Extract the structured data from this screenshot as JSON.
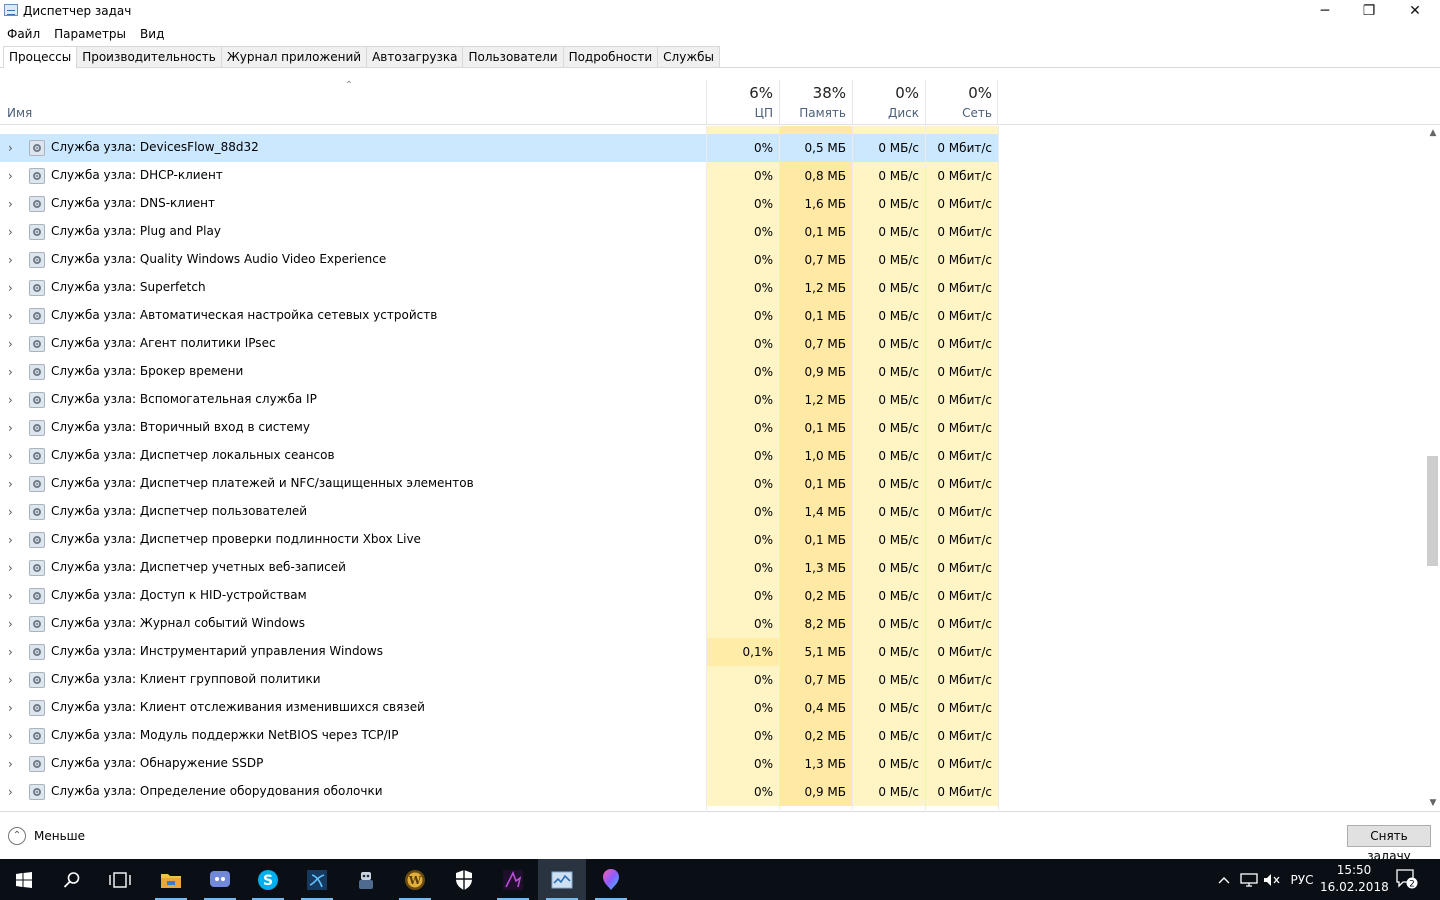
{
  "window": {
    "title": "Диспетчер задач",
    "minimize": "─",
    "maximize": "❐",
    "close": "✕"
  },
  "menu": [
    "Файл",
    "Параметры",
    "Вид"
  ],
  "tabs": [
    {
      "label": "Процессы",
      "active": true
    },
    {
      "label": "Производительность",
      "active": false
    },
    {
      "label": "Журнал приложений",
      "active": false
    },
    {
      "label": "Автозагрузка",
      "active": false
    },
    {
      "label": "Пользователи",
      "active": false
    },
    {
      "label": "Подробности",
      "active": false
    },
    {
      "label": "Службы",
      "active": false
    }
  ],
  "columns": {
    "name": "Имя",
    "cpu": {
      "pct": "6%",
      "label": "ЦП"
    },
    "memory": {
      "pct": "38%",
      "label": "Память"
    },
    "disk": {
      "pct": "0%",
      "label": "Диск"
    },
    "network": {
      "pct": "0%",
      "label": "Сеть"
    }
  },
  "processes": [
    {
      "name": "Служба узла: DevicesFlow_88d32",
      "cpu": "0%",
      "mem": "0,5 МБ",
      "disk": "0 МБ/с",
      "net": "0 Мбит/с",
      "selected": true
    },
    {
      "name": "Служба узла: DHCP-клиент",
      "cpu": "0%",
      "mem": "0,8 МБ",
      "disk": "0 МБ/с",
      "net": "0 Мбит/с"
    },
    {
      "name": "Служба узла: DNS-клиент",
      "cpu": "0%",
      "mem": "1,6 МБ",
      "disk": "0 МБ/с",
      "net": "0 Мбит/с"
    },
    {
      "name": "Служба узла: Plug and Play",
      "cpu": "0%",
      "mem": "0,1 МБ",
      "disk": "0 МБ/с",
      "net": "0 Мбит/с"
    },
    {
      "name": "Служба узла: Quality Windows Audio Video Experience",
      "cpu": "0%",
      "mem": "0,7 МБ",
      "disk": "0 МБ/с",
      "net": "0 Мбит/с"
    },
    {
      "name": "Служба узла: Superfetch",
      "cpu": "0%",
      "mem": "1,2 МБ",
      "disk": "0 МБ/с",
      "net": "0 Мбит/с"
    },
    {
      "name": "Служба узла: Автоматическая настройка сетевых устройств",
      "cpu": "0%",
      "mem": "0,1 МБ",
      "disk": "0 МБ/с",
      "net": "0 Мбит/с"
    },
    {
      "name": "Служба узла: Агент политики IPsec",
      "cpu": "0%",
      "mem": "0,7 МБ",
      "disk": "0 МБ/с",
      "net": "0 Мбит/с"
    },
    {
      "name": "Служба узла: Брокер времени",
      "cpu": "0%",
      "mem": "0,9 МБ",
      "disk": "0 МБ/с",
      "net": "0 Мбит/с"
    },
    {
      "name": "Служба узла: Вспомогательная служба IP",
      "cpu": "0%",
      "mem": "1,2 МБ",
      "disk": "0 МБ/с",
      "net": "0 Мбит/с"
    },
    {
      "name": "Служба узла: Вторичный вход в систему",
      "cpu": "0%",
      "mem": "0,1 МБ",
      "disk": "0 МБ/с",
      "net": "0 Мбит/с"
    },
    {
      "name": "Служба узла: Диспетчер локальных сеансов",
      "cpu": "0%",
      "mem": "1,0 МБ",
      "disk": "0 МБ/с",
      "net": "0 Мбит/с"
    },
    {
      "name": "Служба узла: Диспетчер платежей и NFC/защищенных элементов",
      "cpu": "0%",
      "mem": "0,1 МБ",
      "disk": "0 МБ/с",
      "net": "0 Мбит/с"
    },
    {
      "name": "Служба узла: Диспетчер пользователей",
      "cpu": "0%",
      "mem": "1,4 МБ",
      "disk": "0 МБ/с",
      "net": "0 Мбит/с"
    },
    {
      "name": "Служба узла: Диспетчер проверки подлинности Xbox Live",
      "cpu": "0%",
      "mem": "0,1 МБ",
      "disk": "0 МБ/с",
      "net": "0 Мбит/с"
    },
    {
      "name": "Служба узла: Диспетчер учетных веб-записей",
      "cpu": "0%",
      "mem": "1,3 МБ",
      "disk": "0 МБ/с",
      "net": "0 Мбит/с"
    },
    {
      "name": "Служба узла: Доступ к HID-устройствам",
      "cpu": "0%",
      "mem": "0,2 МБ",
      "disk": "0 МБ/с",
      "net": "0 Мбит/с"
    },
    {
      "name": "Служба узла: Журнал событий Windows",
      "cpu": "0%",
      "mem": "8,2 МБ",
      "disk": "0 МБ/с",
      "net": "0 Мбит/с"
    },
    {
      "name": "Служба узла: Инструментарий управления Windows",
      "cpu": "0,1%",
      "mem": "5,1 МБ",
      "disk": "0 МБ/с",
      "net": "0 Мбит/с",
      "hi": true
    },
    {
      "name": "Служба узла: Клиент групповой политики",
      "cpu": "0%",
      "mem": "0,7 МБ",
      "disk": "0 МБ/с",
      "net": "0 Мбит/с"
    },
    {
      "name": "Служба узла: Клиент отслеживания изменившихся связей",
      "cpu": "0%",
      "mem": "0,4 МБ",
      "disk": "0 МБ/с",
      "net": "0 Мбит/с"
    },
    {
      "name": "Служба узла: Модуль поддержки NetBIOS через TCP/IP",
      "cpu": "0%",
      "mem": "0,2 МБ",
      "disk": "0 МБ/с",
      "net": "0 Мбит/с"
    },
    {
      "name": "Служба узла: Обнаружение SSDP",
      "cpu": "0%",
      "mem": "1,3 МБ",
      "disk": "0 МБ/с",
      "net": "0 Мбит/с"
    },
    {
      "name": "Служба узла: Определение оборудования оболочки",
      "cpu": "0%",
      "mem": "0,9 МБ",
      "disk": "0 МБ/с",
      "net": "0 Мбит/с"
    }
  ],
  "footer": {
    "fewer_details": "Меньше",
    "end_task": "Снять задачу"
  },
  "taskbar": {
    "apps": [
      "windows-start-icon",
      "search-icon",
      "task-view-icon",
      "file-explorer-icon",
      "discord-icon",
      "skype-icon",
      "app-icon-blue",
      "game-app-icon",
      "warcraft-icon",
      "shield-app-icon",
      "purple-app-icon",
      "task-manager-icon",
      "balloon-app-icon"
    ],
    "language": "РУС",
    "time": "15:50",
    "date": "16.02.2018",
    "notifications": "2"
  }
}
